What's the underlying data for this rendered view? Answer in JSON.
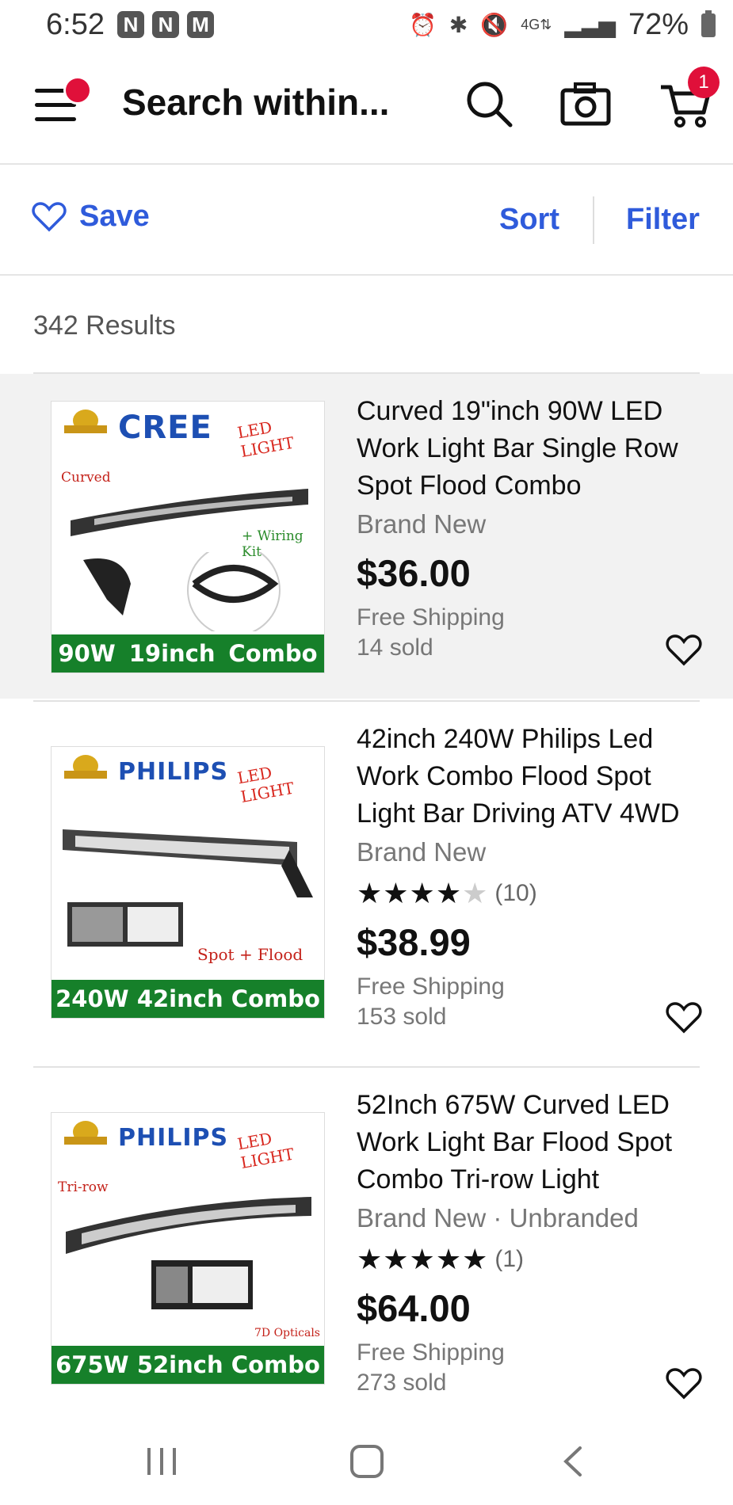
{
  "status_bar": {
    "time": "6:52",
    "battery": "72%",
    "left_icons": [
      "n-icon",
      "n-icon",
      "gmail-icon"
    ],
    "right_icons": [
      "alarm-icon",
      "bluetooth-icon",
      "mute-icon",
      "lte-icon",
      "signal-icon",
      "battery-icon"
    ]
  },
  "header": {
    "search_text": "Search within...",
    "cart_count": "1",
    "accent_color": "#e0103a"
  },
  "actions": {
    "save_label": "Save",
    "sort_label": "Sort",
    "filter_label": "Filter",
    "link_color": "#2f5bdb"
  },
  "results_count": "342 Results",
  "items": [
    {
      "title": "Curved 19\"inch 90W LED Work Light Bar Single Row Spot Flood Combo",
      "condition": "Brand New",
      "price": "$36.00",
      "shipping": "Free Shipping",
      "sold": "14 sold",
      "image": {
        "brand": "CREE",
        "led_text": "LED LIGHT",
        "tag1": "Curved",
        "tag2": "+ Wiring Kit",
        "banner": [
          "90W",
          "19inch",
          "Combo"
        ]
      }
    },
    {
      "title": "42inch 240W Philips Led Work Combo Flood Spot Light Bar Driving ATV 4WD",
      "condition": "Brand New",
      "rating": 4,
      "stars": "★★★★",
      "stars_empty": "★",
      "rating_count": "(10)",
      "price": "$38.99",
      "shipping": "Free Shipping",
      "sold": "153 sold",
      "image": {
        "brand": "PHILIPS",
        "led_text": "LED LIGHT",
        "tag1": "Spot + Flood",
        "banner": [
          "240W",
          "42inch",
          "Combo"
        ]
      }
    },
    {
      "title": "52Inch 675W Curved LED Work Light Bar Flood Spot Combo Tri-row Light",
      "condition": "Brand New · Unbranded",
      "rating": 5,
      "stars": "★★★★★",
      "rating_count": "(1)",
      "price": "$64.00",
      "shipping": "Free Shipping",
      "sold": "273 sold",
      "image": {
        "brand": "PHILIPS",
        "led_text": "LED LIGHT",
        "tag1": "Tri-row",
        "tag2": "7D Opticals",
        "banner": [
          "675W",
          "52inch",
          "Combo"
        ]
      }
    }
  ],
  "nav_bar": [
    "recents-icon",
    "home-icon",
    "back-icon"
  ]
}
